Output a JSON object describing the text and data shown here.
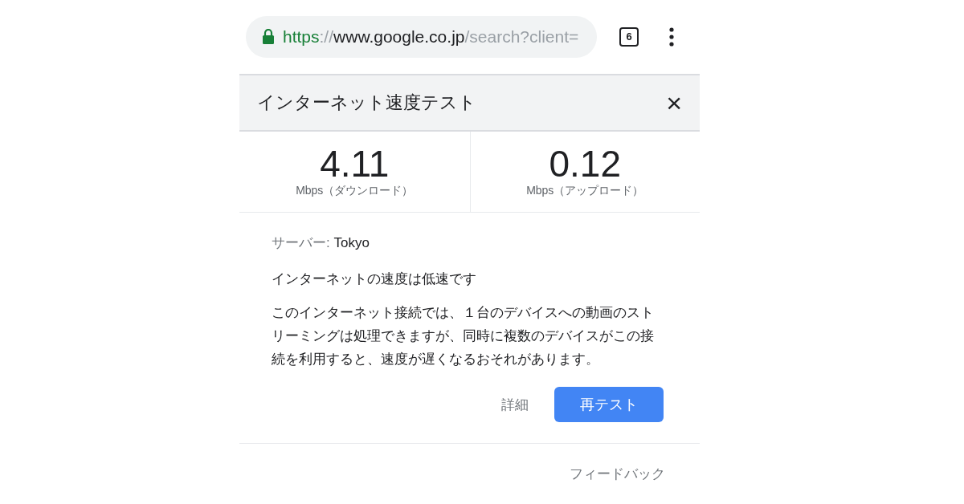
{
  "address_bar": {
    "scheme": "https",
    "separator": "://",
    "host": "www.google.co.jp",
    "path": "/search?client=",
    "secure": true
  },
  "tab_count": "6",
  "card": {
    "title": "インターネット速度テスト",
    "close": "×",
    "results": [
      {
        "value": "4.11",
        "unit": "Mbps（ダウンロード）"
      },
      {
        "value": "0.12",
        "unit": "Mbps（アップロード）"
      }
    ],
    "server_label": "サーバー:",
    "server": "Tokyo",
    "verdict": "インターネットの速度は低速です",
    "description": "このインターネット接続では、１台のデバイスへの動画のストリーミングは処理できますが、同時に複数のデバイスがこの接続を利用すると、速度が遅くなるおそれがあります。",
    "details_link": "詳細",
    "retest_button": "再テスト",
    "feedback_link": "フィードバック"
  }
}
